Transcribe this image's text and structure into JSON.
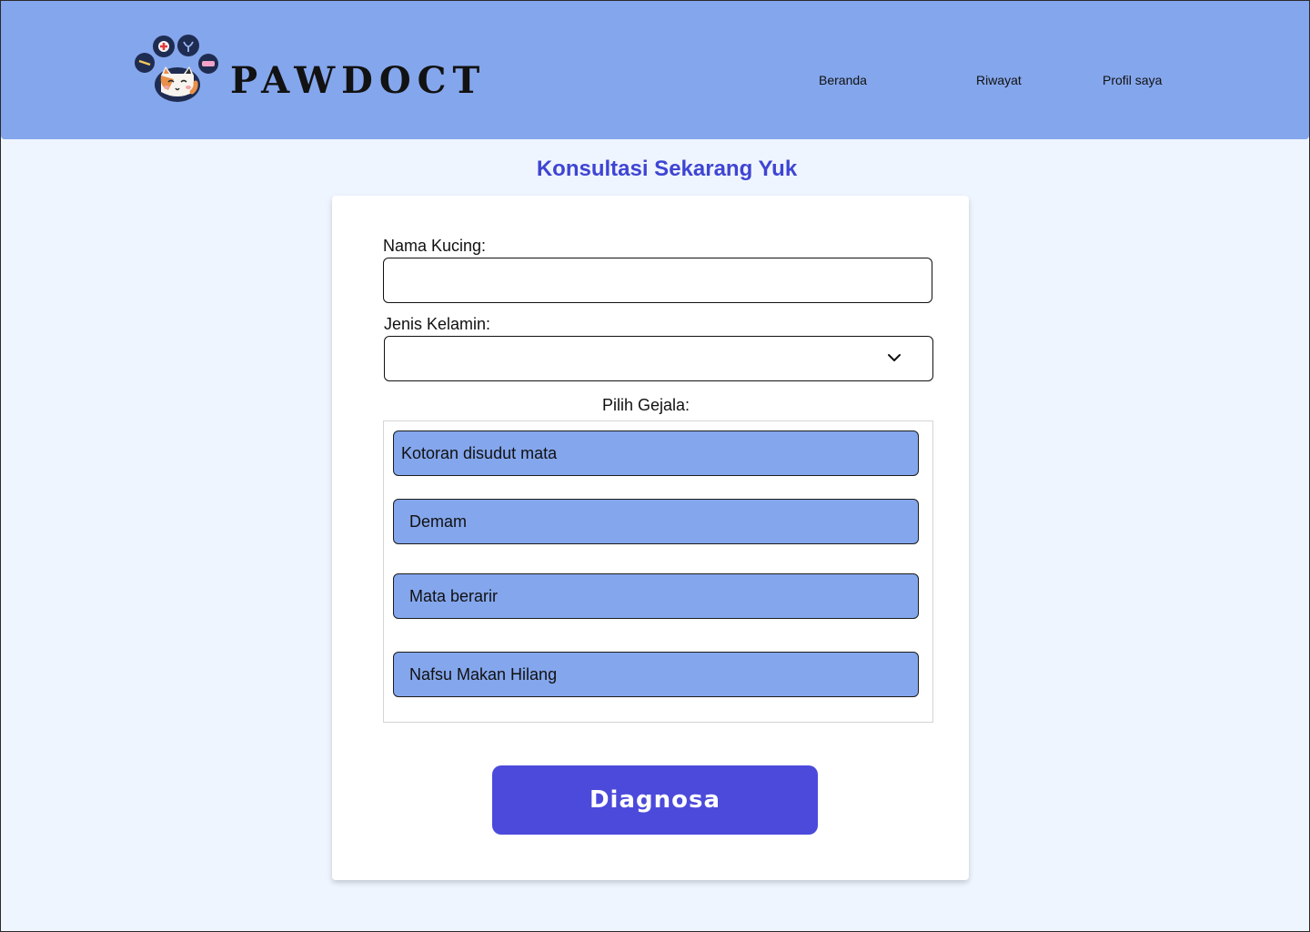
{
  "app": {
    "brand": "PAWDOCT"
  },
  "nav": {
    "items": [
      "Beranda",
      "Riwayat",
      "Profil saya"
    ]
  },
  "page": {
    "title": "Konsultasi Sekarang Yuk"
  },
  "form": {
    "name_label": "Nama Kucing:",
    "name_value": "",
    "gender_label": "Jenis Kelamin:",
    "gender_value": "",
    "symptoms_label": "Pilih Gejala:",
    "symptoms": [
      "Kotoran disudut mata",
      "Demam",
      "Mata berarir",
      "Nafsu Makan Hilang"
    ],
    "submit_label": "Diagnosa"
  },
  "colors": {
    "header_bg": "#84a6ec",
    "page_bg": "#eff5ff",
    "title": "#3f45d2",
    "button": "#4c4adb",
    "symptom_bg": "#84a6ec"
  },
  "icons": {
    "logo": "cat-paw-logo",
    "select": "chevron-down-icon"
  }
}
